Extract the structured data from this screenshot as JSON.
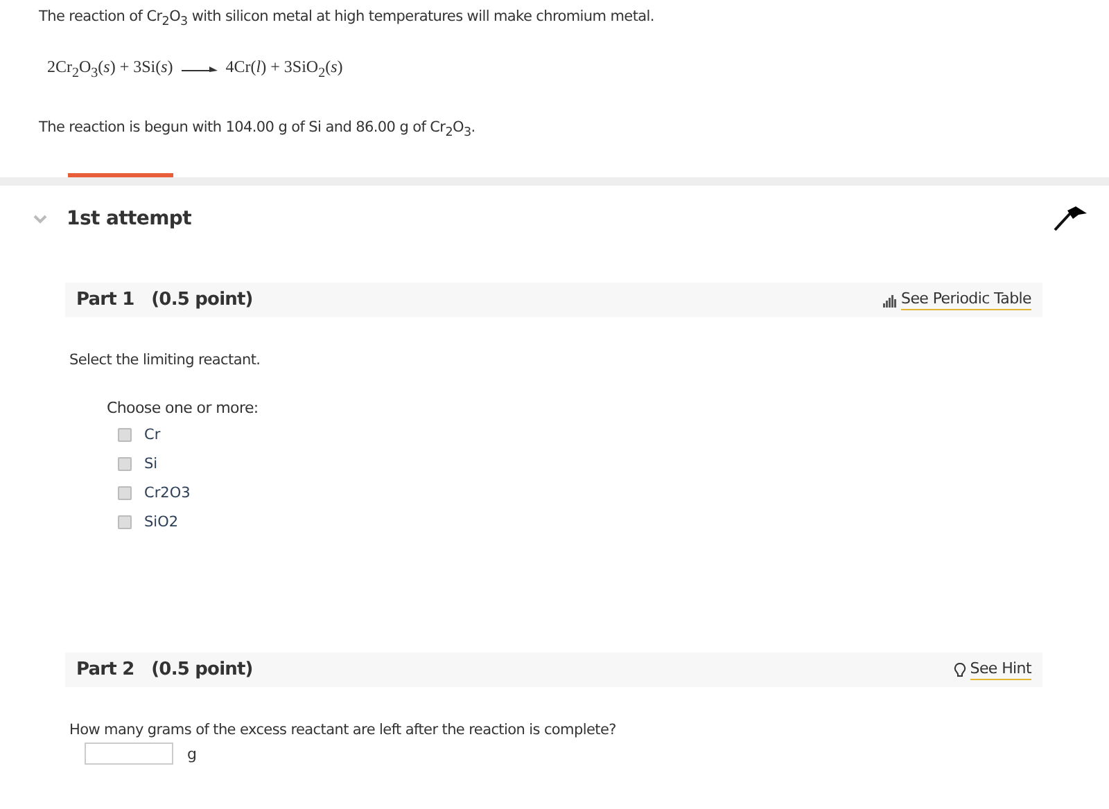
{
  "problem": {
    "intro": "The reaction of Cr$_{2}$O$_{3}$ with silicon metal at high temperatures will make chromium metal.",
    "equation": {
      "reactants": "2Cr$_{2}$O$_{3}$(*s*) + 3Si(*s*)",
      "products": "4Cr(*l*) + 3SiO$_{2}$(*s*)"
    },
    "given": "The reaction is begun with 104.00 g of Si and 86.00 g of Cr$_{2}$O$_{3}$."
  },
  "attempt": {
    "title": "1st attempt"
  },
  "parts": [
    {
      "kind": "choice",
      "title": "Part 1",
      "points": "(0.5 point)",
      "tool": {
        "kind": "periodic",
        "label": "See Periodic Table"
      },
      "prompt": "Select the limiting reactant.",
      "instruction": "Choose one or more:",
      "options": [
        {
          "label": "Cr",
          "checked": false
        },
        {
          "label": "Si",
          "checked": false
        },
        {
          "label": "Cr2O3",
          "checked": false
        },
        {
          "label": "SiO2",
          "checked": false
        }
      ]
    },
    {
      "kind": "numeric",
      "title": "Part 2",
      "points": "(0.5 point)",
      "tool": {
        "kind": "hint",
        "label": "See Hint"
      },
      "prompt": "How many grams of the excess reactant are left after the reaction is complete?",
      "unit": "g"
    }
  ]
}
